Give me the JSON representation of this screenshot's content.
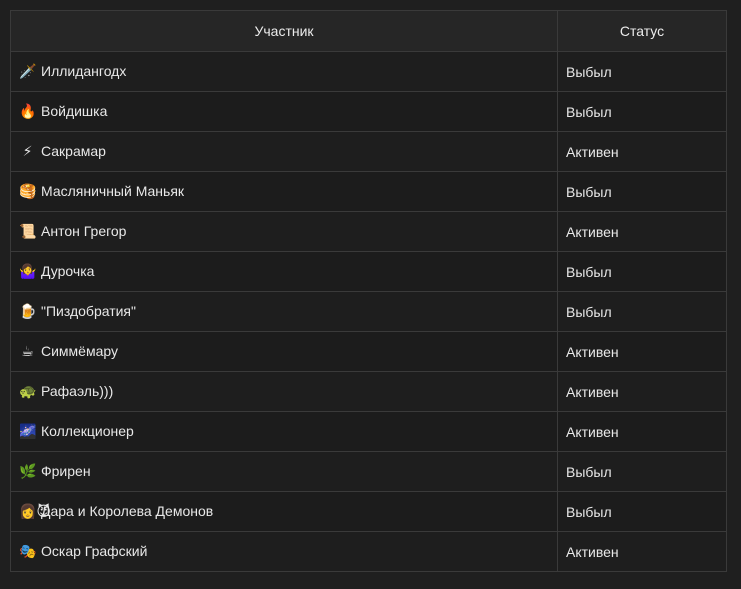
{
  "table": {
    "headers": [
      "Участник",
      "Статус"
    ],
    "rows": [
      {
        "icon": "🗡️",
        "icon_name": "dagger-icon",
        "name": "Иллидангодх",
        "status": "Выбыл"
      },
      {
        "icon": "🔥",
        "icon_name": "fire-icon",
        "name": "Войдишка",
        "status": "Выбыл"
      },
      {
        "icon": "⚡",
        "icon_name": "lightning-icon",
        "name": "Сакрамар",
        "status": "Активен"
      },
      {
        "icon": "🥞",
        "icon_name": "pancakes-icon",
        "name": "Масляничный Маньяк",
        "status": "Выбыл"
      },
      {
        "icon": "📜",
        "icon_name": "scroll-icon",
        "name": "Антон Грегор",
        "status": "Активен"
      },
      {
        "icon": "🤷‍♀️",
        "icon_name": "shrug-icon",
        "name": "Дурочка",
        "status": "Выбыл"
      },
      {
        "icon": "🍺",
        "icon_name": "beer-icon",
        "name": "\"Пиздобратия\"",
        "status": "Выбыл"
      },
      {
        "icon": "☕",
        "icon_name": "coffee-icon",
        "name": "Симмёмару",
        "status": "Активен"
      },
      {
        "icon": "🐢",
        "icon_name": "turtle-icon",
        "name": "Рафаэль)))",
        "status": "Активен"
      },
      {
        "icon": "🌌",
        "icon_name": "galaxy-icon",
        "name": "Коллекционер",
        "status": "Активен"
      },
      {
        "icon": "🌿",
        "icon_name": "herb-icon",
        "name": "Фрирен",
        "status": "Выбыл"
      },
      {
        "icon": "👩😈",
        "icon_name": "woman-devil-icon",
        "name": "Дара и Королева Демонов",
        "status": "Выбыл"
      },
      {
        "icon": "🎭",
        "icon_name": "theater-masks-icon",
        "name": "Оскар Графский",
        "status": "Активен"
      }
    ]
  }
}
